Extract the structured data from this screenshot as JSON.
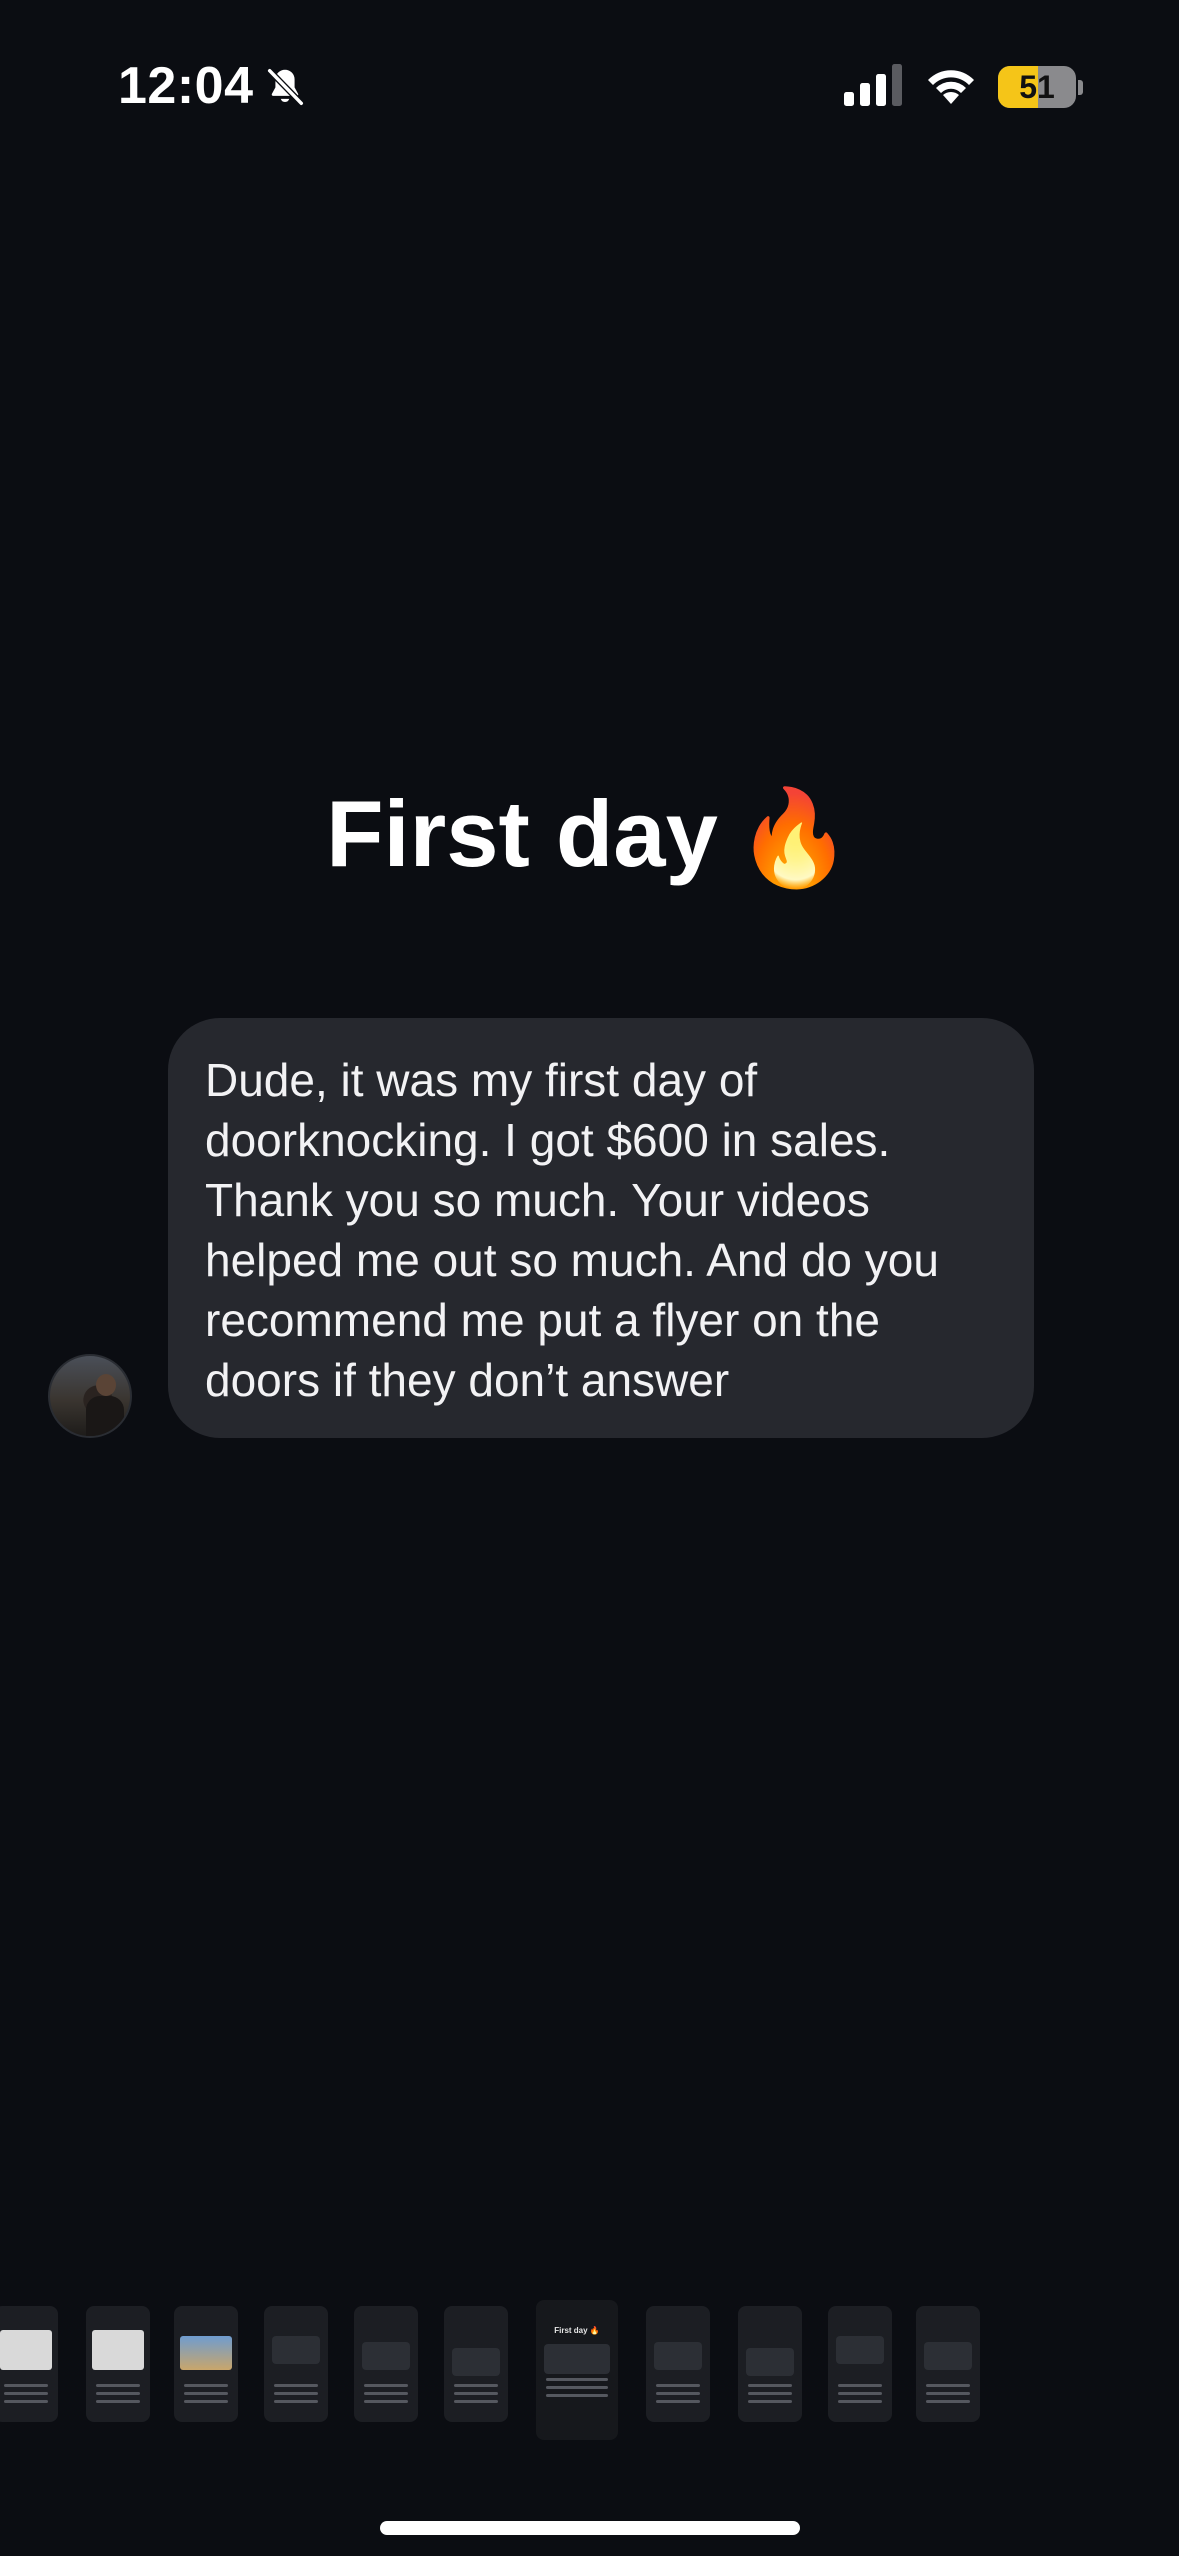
{
  "status_bar": {
    "time": "12:04",
    "battery_level": "51",
    "battery_percent": 51,
    "battery_color": "#f5c518",
    "icons": [
      "bell-slash-icon",
      "cellular-signal-icon",
      "wifi-icon",
      "battery-icon"
    ]
  },
  "story": {
    "title": "First day",
    "title_emoji": "🔥"
  },
  "message": {
    "text": "Dude, it was my first day of doorknocking. I got $600 in sales. Thank you so much. Your videos helped me out so much. And do you recommend me put a flyer on the doors if they don’t answer",
    "bubble_color": "#26282e"
  },
  "thumbnails": {
    "count": 11,
    "active_index": 6,
    "active_label": "First day 🔥"
  },
  "colors": {
    "background": "#0b0d12",
    "text": "#ffffff"
  }
}
